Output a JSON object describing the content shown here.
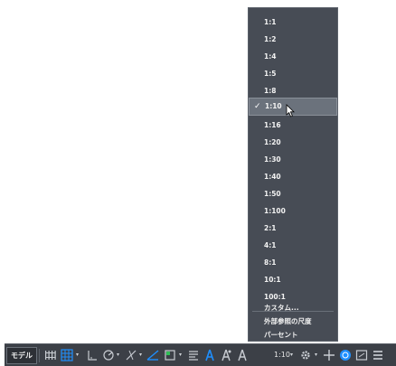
{
  "scale_menu": {
    "items": [
      {
        "label": "1:1",
        "checked": false
      },
      {
        "label": "1:2",
        "checked": false
      },
      {
        "label": "1:4",
        "checked": false
      },
      {
        "label": "1:5",
        "checked": false
      },
      {
        "label": "1:8",
        "checked": false
      },
      {
        "label": "1:10",
        "checked": true
      },
      {
        "label": "1:16",
        "checked": false
      },
      {
        "label": "1:20",
        "checked": false
      },
      {
        "label": "1:30",
        "checked": false
      },
      {
        "label": "1:40",
        "checked": false
      },
      {
        "label": "1:50",
        "checked": false
      },
      {
        "label": "1:100",
        "checked": false
      },
      {
        "label": "2:1",
        "checked": false
      },
      {
        "label": "4:1",
        "checked": false
      },
      {
        "label": "8:1",
        "checked": false
      },
      {
        "label": "10:1",
        "checked": false
      },
      {
        "label": "100:1",
        "checked": false
      },
      {
        "label": "カスタム...",
        "checked": false
      }
    ],
    "extra_items": [
      {
        "label": "外部参照の尺度"
      },
      {
        "label": "パーセント"
      }
    ],
    "check_glyph": "✓"
  },
  "statusbar": {
    "model_tab": "モデル",
    "annotation_scale": "1:10",
    "caret": "▾",
    "icons": [
      "grid-icon",
      "snap-icon",
      "ortho-icon",
      "polar-icon",
      "osnap-icon",
      "dynamic-ucs-icon",
      "lineweight-icon",
      "annotation-visibility-icon",
      "auto-scale-icon",
      "annotation-scale-icon",
      "workspace-gear-icon",
      "plus-icon",
      "isolate-icon",
      "fullscreen-icon",
      "customize-icon"
    ],
    "accent_color": "#1e8fff"
  }
}
